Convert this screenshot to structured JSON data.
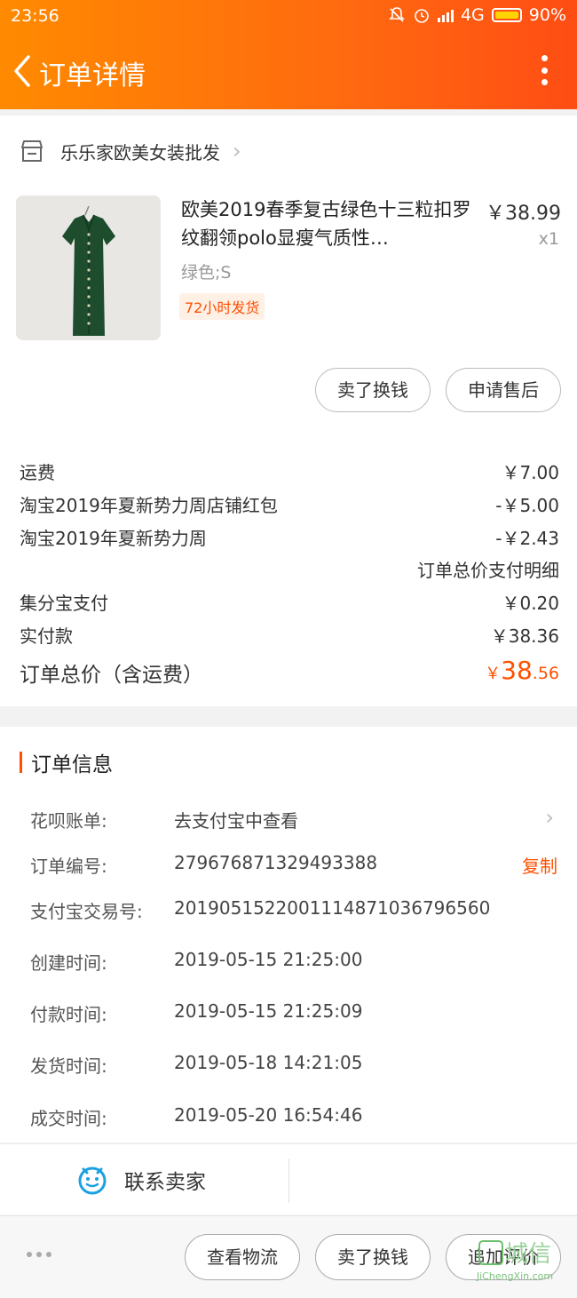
{
  "status_bar": {
    "time": "23:56",
    "network": "4G",
    "battery": "90%"
  },
  "header": {
    "title": "订单详情"
  },
  "shop": {
    "name": "乐乐家欧美女装批发"
  },
  "product": {
    "title": "欧美2019春季复古绿色十三粒扣罗纹翻领polo显瘦气质性…",
    "price": "￥38.99",
    "qty": "x1",
    "sku": "绿色;S",
    "tag": "72小时发货"
  },
  "product_actions": {
    "sell": "卖了换钱",
    "after_sale": "申请售后"
  },
  "fees": [
    {
      "label": "运费",
      "value": "￥7.00"
    },
    {
      "label": "淘宝2019年夏新势力周店铺红包",
      "value": "-￥5.00"
    },
    {
      "label": "淘宝2019年夏新势力周",
      "value": "-￥2.43"
    }
  ],
  "detail_link": "订单总价支付明细",
  "payments": [
    {
      "label": "集分宝支付",
      "value": "￥0.20"
    },
    {
      "label": "实付款",
      "value": "￥38.36"
    }
  ],
  "total": {
    "label": "订单总价（含运费）",
    "currency": "￥",
    "integer": "38",
    "decimal": ".56"
  },
  "order_info": {
    "title": "订单信息",
    "rows": [
      {
        "key": "花呗账单:",
        "value": "去支付宝中查看"
      },
      {
        "key": "订单编号:",
        "value": "279676871329493388",
        "action": "复制"
      },
      {
        "key": "支付宝交易号:",
        "value": "2019051522001114871036796560"
      },
      {
        "key": "创建时间:",
        "value": "2019-05-15 21:25:00"
      },
      {
        "key": "付款时间:",
        "value": "2019-05-15 21:25:09"
      },
      {
        "key": "发货时间:",
        "value": "2019-05-18 14:21:05"
      },
      {
        "key": "成交时间:",
        "value": "2019-05-20 16:54:46"
      }
    ]
  },
  "contact": {
    "label": "联系卖家"
  },
  "bottom_actions": {
    "logistics": "查看物流",
    "sell": "卖了换钱",
    "review": "追加评价"
  },
  "watermark": {
    "text": "城信",
    "domain": "JiChengXin.com"
  },
  "colors": {
    "accent": "#ff5000",
    "header_start": "#ff8a00",
    "header_end": "#ff4d14",
    "contact_icon": "#1ba0e1"
  }
}
